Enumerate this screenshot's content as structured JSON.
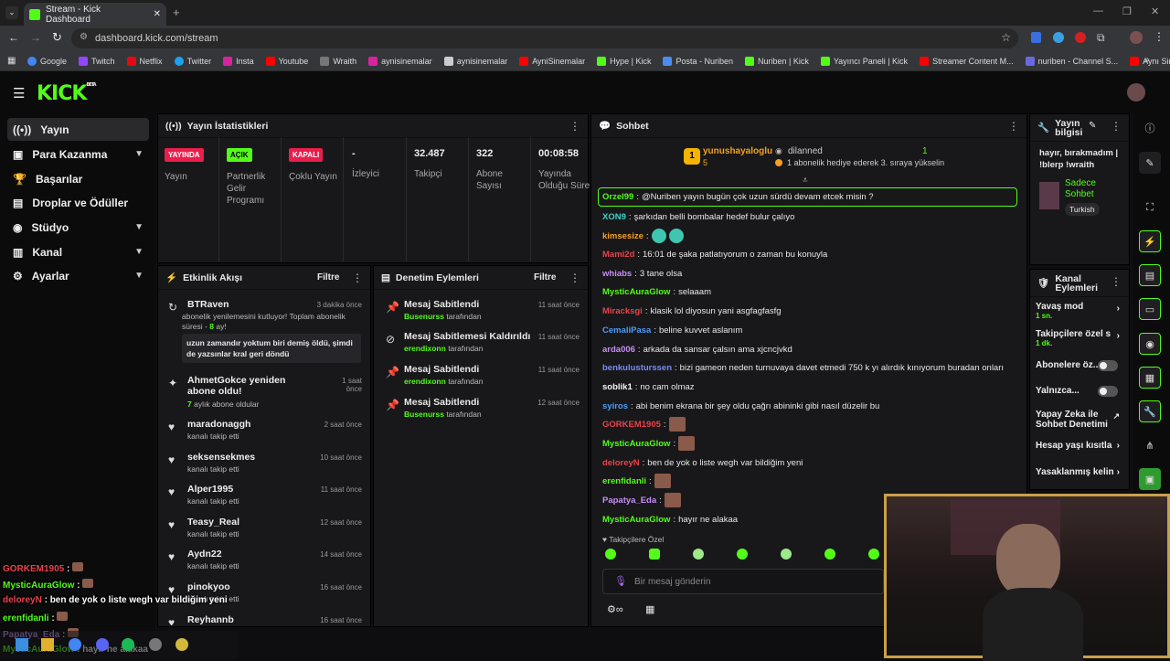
{
  "browser": {
    "tab_title": "Stream - Kick Dashboard",
    "url": "dashboard.kick.com/stream",
    "bookmarks": [
      "Google",
      "Twitch",
      "Netflix",
      "Twitter",
      "Insta",
      "Youtube",
      "Wraith",
      "aynisinemalar",
      "aynisinemalar",
      "AyniSinemalar",
      "Hype | Kick",
      "Posta - Nuriben",
      "Nuriben | Kick",
      "Yayıncı Paneli | Kick",
      "Streamer Content M...",
      "nuriben - Channel S...",
      "Aynı Sinemalar - Ça..."
    ]
  },
  "sidebar": {
    "logo": "KICK",
    "logo_sup": "BETA",
    "items": [
      {
        "label": "Yayın"
      },
      {
        "label": "Para Kazanma"
      },
      {
        "label": "Başarılar"
      },
      {
        "label": "Droplar ve Ödüller"
      },
      {
        "label": "Stüdyo"
      },
      {
        "label": "Kanal"
      },
      {
        "label": "Ayarlar"
      }
    ]
  },
  "stats": {
    "title": "Yayın İstatistikleri",
    "items": [
      {
        "badge": "YAYINDA",
        "label": "Yayın",
        "color": "#e91e4c"
      },
      {
        "badge": "AÇIK",
        "label": "Partnerlik Gelir Programı",
        "color": "#53fc18"
      },
      {
        "badge": "KAPALI",
        "label": "Çoklu Yayın",
        "color": "#e91e4c"
      },
      {
        "value": "-",
        "label": "İzleyici"
      },
      {
        "value": "32.487",
        "label": "Takipçi"
      },
      {
        "value": "322",
        "label": "Abone Sayısı"
      },
      {
        "value": "00:08:58",
        "label": "Yayında Olduğu Süre"
      }
    ]
  },
  "activity": {
    "title": "Etkinlik Akışı",
    "filter": "Filtre",
    "items": [
      {
        "name": "BTRaven",
        "time": "3 dakika önce",
        "sub": "abonelik yenilemesini kutluyor! Toplam abonelik süresi -",
        "months": "8",
        "months_suffix": "ay!",
        "quote": "uzun zamandır yoktum biri demiş öldü, şimdi de yazsınlar kral geri döndü"
      },
      {
        "name": "AhmetGokce yeniden abone oldu!",
        "time": "1 saat önce",
        "months": "7",
        "sub": "aylık abone oldular"
      },
      {
        "name": "maradonaggh",
        "time": "2 saat önce",
        "sub": "kanalı takip etti"
      },
      {
        "name": "seksensekmes",
        "time": "10 saat önce",
        "sub": "kanalı takip etti"
      },
      {
        "name": "Alper1995",
        "time": "11 saat önce",
        "sub": "kanalı takip etti"
      },
      {
        "name": "Teasy_Real",
        "time": "12 saat önce",
        "sub": "kanalı takip etti"
      },
      {
        "name": "Aydn22",
        "time": "14 saat önce",
        "sub": "kanalı takip etti"
      },
      {
        "name": "pinokyoo",
        "time": "16 saat önce",
        "sub": "kanalı takip etti"
      },
      {
        "name": "Reyhannb",
        "time": "16 saat önce",
        "sub": ""
      }
    ]
  },
  "moderation": {
    "title": "Denetim Eylemleri",
    "filter": "Filtre",
    "suffix": "tarafından",
    "items": [
      {
        "action": "Mesaj Sabitlendi",
        "time": "11 saat önce",
        "by": "Busenurss"
      },
      {
        "action": "Mesaj Sabitlemesi Kaldırıldı",
        "time": "11 saat önce",
        "by": "erendixonn"
      },
      {
        "action": "Mesaj Sabitlendi",
        "time": "11 saat önce",
        "by": "erendixonn"
      },
      {
        "action": "Mesaj Sabitlendi",
        "time": "12 saat önce",
        "by": "Busenurss"
      }
    ]
  },
  "chat": {
    "title": "Sohbet",
    "gift_leader": {
      "name": "yunushayaloglu",
      "count": "5",
      "rank": "1"
    },
    "gift_second": {
      "name": "dilanned",
      "count": "1",
      "text": "1 abonelik hediye ederek 3. sıraya yükselin"
    },
    "messages": [
      {
        "user": "Orzel99",
        "color": "#53fc18",
        "text": "@Nuriben yayın bugün çok uzun sürdü devam etcek misin ?"
      },
      {
        "user": "XON9",
        "color": "#3fd2c7",
        "text": "şarkıdan belli bombalar hedef bulur çalıyo"
      },
      {
        "user": "kimsesize",
        "color": "#f4a020",
        "text": ""
      },
      {
        "user": "Mami2d",
        "color": "#e9424b",
        "text": "16:01 de şaka patlatıyorum o zaman bu konuyla"
      },
      {
        "user": "whiabs",
        "color": "#c58ef5",
        "text": "3 tane olsa"
      },
      {
        "user": "MysticAuraGlow",
        "color": "#53fc18",
        "text": "selaaam"
      },
      {
        "user": "Miracksgi",
        "color": "#e9424b",
        "text": "klasik lol diyosun yani asgfagfasfg"
      },
      {
        "user": "CemaliPasa",
        "color": "#4e9bf5",
        "text": "beline kuvvet aslanım"
      },
      {
        "user": "arda006",
        "color": "#c58ef5",
        "text": "arkada da sansar çalsın ama xjcncjvkd"
      },
      {
        "user": "benkulusturssen",
        "color": "#7c8af5",
        "text": "bizi gameon neden turnuvaya davet etmedi 750 k yı alırdık kınıyorum buradan onları"
      },
      {
        "user": "soblik1",
        "color": "#f5f5f5",
        "text": "no cam olmaz"
      },
      {
        "user": "syiros",
        "color": "#4e9bf5",
        "text": "abi benim ekrana bir şey oldu çağrı abininki gibi nasıl düzelir bu"
      },
      {
        "user": "GORKEM1905",
        "color": "#e9424b",
        "text": ""
      },
      {
        "user": "MysticAuraGlow",
        "color": "#53fc18",
        "text": ""
      },
      {
        "user": "deloreyN",
        "color": "#e9424b",
        "text": "ben de yok o liste wegh var bildiğim yeni"
      },
      {
        "user": "erenfidanli",
        "color": "#53fc18",
        "text": ""
      },
      {
        "user": "Papatya_Eda",
        "color": "#c58ef5",
        "text": ""
      },
      {
        "user": "MysticAuraGlow",
        "color": "#53fc18",
        "text": "hayır ne alakaa"
      }
    ],
    "followers_only": "Takipçilere Özel",
    "input_placeholder": "Bir mesaj gönderin"
  },
  "stream_info": {
    "title": "Yayın bilgisi",
    "stream_title": "hayır, bırakmadım | !blerp !wraith",
    "category": "Sadece Sohbet",
    "tag": "Turkish"
  },
  "channel_actions": {
    "title": "Kanal Eylemleri",
    "items": [
      {
        "label": "Yavaş mod",
        "sub": "1 sn."
      },
      {
        "label": "Takipçilere özel s",
        "sub": "1 dk."
      },
      {
        "label": "Abonelere öz..."
      },
      {
        "label": "Yalnızca..."
      },
      {
        "label": "Yapay Zeka ile Sohbet Denetimi"
      },
      {
        "label": "Hesap yaşı kısıtla"
      },
      {
        "label": "Yasaklanmış kelin"
      }
    ]
  },
  "overlay_chat": [
    {
      "user": "GORKEM1905",
      "color": "#e9424b",
      "text": ""
    },
    {
      "user": "MysticAuraGlow",
      "color": "#53fc18",
      "text": ""
    },
    {
      "user": "deloreyN",
      "color": "#e9424b",
      "text": "ben de yok o liste wegh var bildiğim yeni"
    },
    {
      "user": "erenfidanli",
      "color": "#53fc18",
      "text": ""
    },
    {
      "user": "Papatya_Eda",
      "color": "#c58ef5",
      "text": ""
    },
    {
      "user": "MysticAuraGlow",
      "color": "#53fc18",
      "text": "hayır ne alakaa"
    }
  ]
}
